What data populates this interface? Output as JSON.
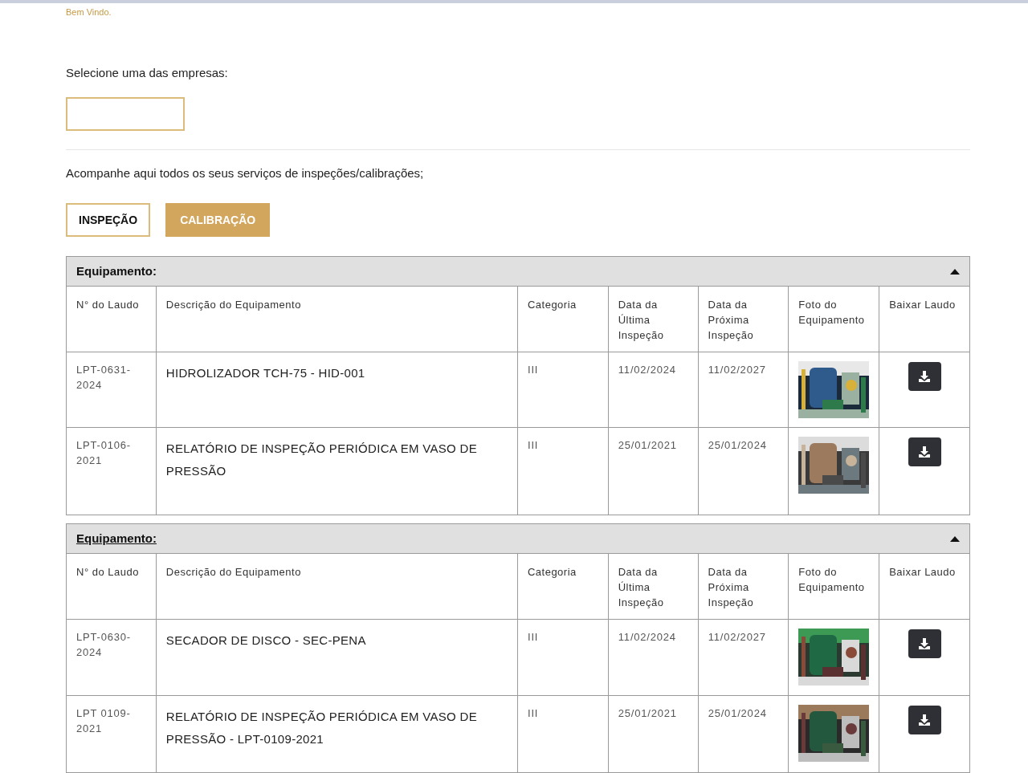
{
  "greeting": "Bem Vindo.",
  "company_select": {
    "label": "Selecione uma das empresas:"
  },
  "intro": "Acompanhe aqui todos os seus serviços de inspeções/calibrações;",
  "tabs": [
    {
      "label": "INSPEÇÃO",
      "selected": false
    },
    {
      "label": "CALIBRAÇÃO",
      "selected": true
    }
  ],
  "groups": [
    {
      "title": "Equipamento:",
      "underlined": false,
      "expanded": true,
      "columns": [
        "N° do Laudo",
        "Descrição do Equipamento",
        "Categoria",
        "Data da Última Inspeção",
        "Data da Próxima Inspeção",
        "Foto do Equipamento",
        "Baixar Laudo"
      ],
      "rows": [
        {
          "laudo": "LPT-0631-2024",
          "descricao": "HIDROLIZADOR TCH-75 - HID-001",
          "categoria": "III",
          "ultima": "11/02/2024",
          "proxima": "11/02/2027"
        },
        {
          "laudo": "LPT-0106-2021",
          "descricao": "RELATÓRIO DE INSPEÇÃO PERIÓDICA EM VASO DE PRESSÃO",
          "categoria": "III",
          "ultima": "25/01/2021",
          "proxima": "25/01/2024"
        }
      ]
    },
    {
      "title": "Equipamento:",
      "underlined": true,
      "expanded": true,
      "columns": [
        "N° do Laudo",
        "Descrição do Equipamento",
        "Categoria",
        "Data da Última Inspeção",
        "Data da Próxima Inspeção",
        "Foto do Equipamento",
        "Baixar Laudo"
      ],
      "rows": [
        {
          "laudo": "LPT-0630-2024",
          "descricao": "SECADOR DE DISCO - SEC-PENA",
          "categoria": "III",
          "ultima": "11/02/2024",
          "proxima": "11/02/2027"
        },
        {
          "laudo": "LPT 0109-2021",
          "descricao": "RELATÓRIO DE INSPEÇÃO PERIÓDICA EM VASO DE PRESSÃO - LPT-0109-2021",
          "categoria": "III",
          "ultima": "25/01/2021",
          "proxima": "25/01/2024"
        }
      ]
    }
  ]
}
